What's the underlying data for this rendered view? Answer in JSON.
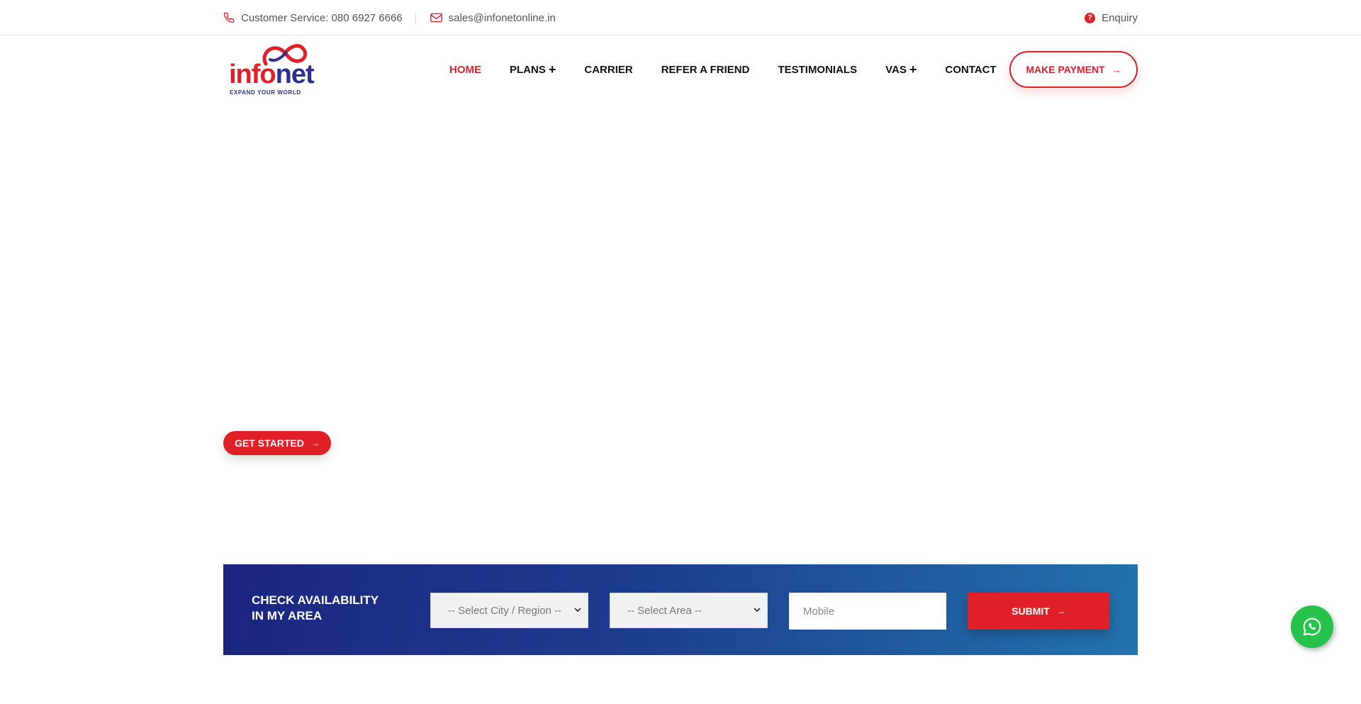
{
  "topbar": {
    "phone_text": "Customer Service: 080 6927 6666",
    "email_text": "sales@infonetonline.in",
    "enquiry_label": "Enquiry"
  },
  "logo": {
    "word_info": "info",
    "word_net": "net",
    "tagline": "EXPAND YOUR WORLD"
  },
  "nav": {
    "items": [
      {
        "label": "HOME",
        "active": true,
        "has_submenu": false
      },
      {
        "label": "PLANS",
        "active": false,
        "has_submenu": true
      },
      {
        "label": "CARRIER",
        "active": false,
        "has_submenu": false
      },
      {
        "label": "REFER A FRIEND",
        "active": false,
        "has_submenu": false
      },
      {
        "label": "TESTIMONIALS",
        "active": false,
        "has_submenu": false
      },
      {
        "label": "VAS",
        "active": false,
        "has_submenu": true
      },
      {
        "label": "CONTACT",
        "active": false,
        "has_submenu": false
      }
    ],
    "submenu_symbol": "+",
    "payment_label": "MAKE PAYMENT"
  },
  "hero": {
    "cta_label": "GET STARTED"
  },
  "availability": {
    "title_line1": "CHECK AVAILABILITY",
    "title_line2": "IN MY AREA",
    "city_select": "-- Select City / Region --",
    "area_select": "-- Select Area --",
    "mobile_placeholder": "Mobile",
    "submit_label": "SUBMIT"
  },
  "icons": {
    "phone": "phone-icon",
    "mail": "mail-icon",
    "enquiry": "question-circle-icon",
    "arrow": "arrow-right-icon",
    "whatsapp": "whatsapp-icon"
  },
  "colors": {
    "brand_red": "#e11f26",
    "brand_navy": "#2b2f8f",
    "band_start": "#1b2580",
    "band_end": "#2273ad",
    "whatsapp_green": "#27c24c"
  }
}
